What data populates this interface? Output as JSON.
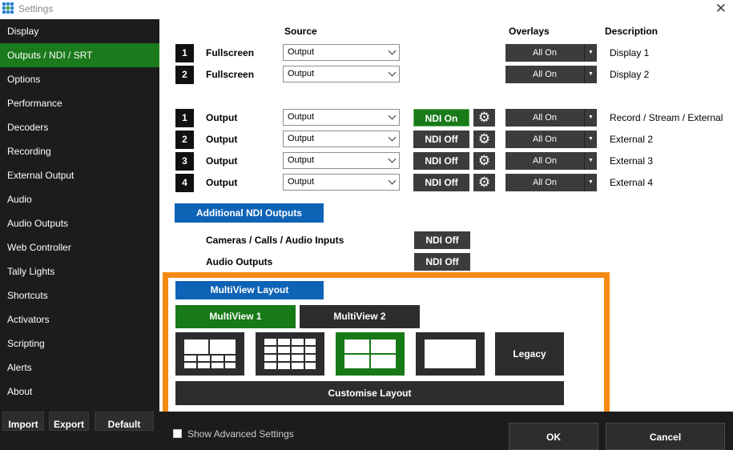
{
  "window": {
    "title": "Settings",
    "close_label": "✕"
  },
  "sidebar": {
    "items": [
      {
        "label": "Display"
      },
      {
        "label": "Outputs / NDI / SRT",
        "active": true
      },
      {
        "label": "Options"
      },
      {
        "label": "Performance"
      },
      {
        "label": "Decoders"
      },
      {
        "label": "Recording"
      },
      {
        "label": "External Output"
      },
      {
        "label": "Audio"
      },
      {
        "label": "Audio Outputs"
      },
      {
        "label": "Web Controller"
      },
      {
        "label": "Tally Lights"
      },
      {
        "label": "Shortcuts"
      },
      {
        "label": "Activators"
      },
      {
        "label": "Scripting"
      },
      {
        "label": "Alerts"
      },
      {
        "label": "About"
      }
    ],
    "import_label": "Import",
    "export_label": "Export",
    "default_label": "Default"
  },
  "headers": {
    "source": "Source",
    "overlays": "Overlays",
    "description": "Description"
  },
  "fullscreen_rows": [
    {
      "num": "1",
      "label": "Fullscreen",
      "source": "Output",
      "overlays": "All On",
      "description": "Display 1"
    },
    {
      "num": "2",
      "label": "Fullscreen",
      "source": "Output",
      "overlays": "All On",
      "description": "Display 2"
    }
  ],
  "output_rows": [
    {
      "num": "1",
      "label": "Output",
      "source": "Output",
      "ndi": "NDI On",
      "ndi_on": true,
      "overlays": "All On",
      "description": "Record / Stream / External"
    },
    {
      "num": "2",
      "label": "Output",
      "source": "Output",
      "ndi": "NDI Off",
      "ndi_on": false,
      "overlays": "All On",
      "description": "External 2"
    },
    {
      "num": "3",
      "label": "Output",
      "source": "Output",
      "ndi": "NDI Off",
      "ndi_on": false,
      "overlays": "All On",
      "description": "External 3"
    },
    {
      "num": "4",
      "label": "Output",
      "source": "Output",
      "ndi": "NDI Off",
      "ndi_on": false,
      "overlays": "All On",
      "description": "External 4"
    }
  ],
  "additional_ndi": {
    "button_label": "Additional NDI Outputs",
    "cameras_label": "Cameras / Calls / Audio Inputs",
    "cameras_state": "NDI Off",
    "audio_label": "Audio Outputs",
    "audio_state": "NDI Off"
  },
  "multiview": {
    "section_label": "MultiView Layout",
    "tab1": "MultiView 1",
    "tab2": "MultiView 2",
    "legacy_label": "Legacy",
    "customise_label": "Customise Layout"
  },
  "footer": {
    "advanced_label": "Show Advanced Settings",
    "ok_label": "OK",
    "cancel_label": "Cancel"
  },
  "colors": {
    "accent_green": "#1b7a1b",
    "accent_blue": "#0d63b6",
    "highlight_orange": "#f58a12",
    "dark_panel": "#1c1c1c"
  }
}
